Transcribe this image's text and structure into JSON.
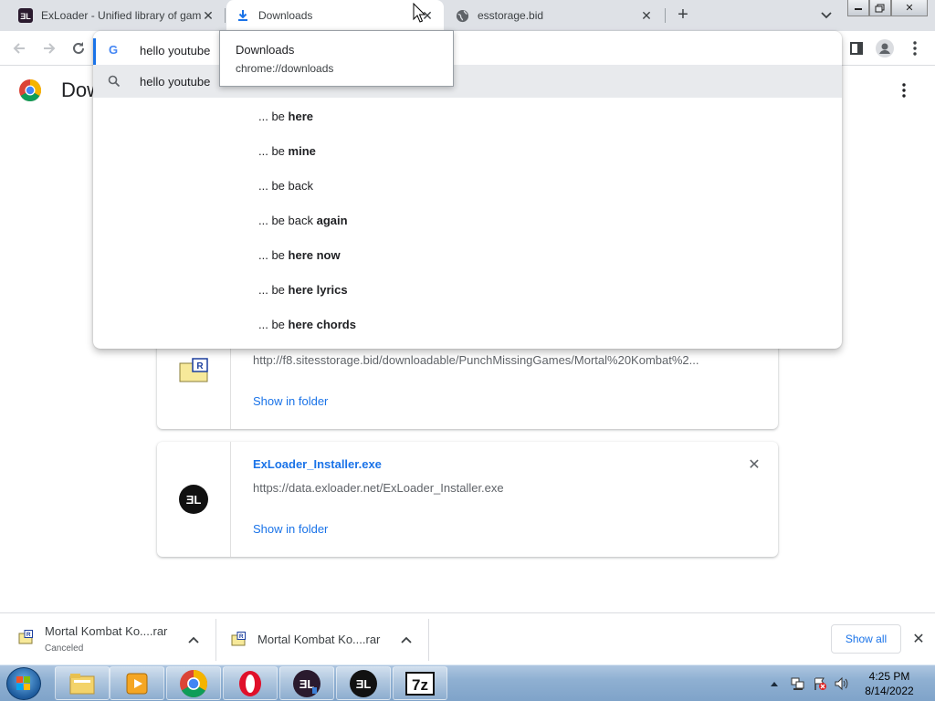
{
  "tabs": [
    {
      "title": "ExLoader - Unified library of games",
      "icon": "exloader-icon",
      "active": false
    },
    {
      "title": "Downloads",
      "icon": "download-icon",
      "active": true
    },
    {
      "title": "esstorage.bid",
      "icon": "globe-icon",
      "active": false
    }
  ],
  "omnibox": {
    "text": "hello youtube",
    "first_suggestion": "hello youtube",
    "suggestions": [
      {
        "prefix": "... be ",
        "bold": "here"
      },
      {
        "prefix": "... be ",
        "bold": "mine"
      },
      {
        "prefix": "... be back",
        "bold": ""
      },
      {
        "prefix": "... be back ",
        "bold": "again"
      },
      {
        "prefix": "... be ",
        "bold": "here now"
      },
      {
        "prefix": "... be ",
        "bold": "here lyrics"
      },
      {
        "prefix": "... be ",
        "bold": "here chords"
      }
    ]
  },
  "tooltip": {
    "title": "Downloads",
    "url": "chrome://downloads"
  },
  "page": {
    "title": "Downloads"
  },
  "downloads": [
    {
      "url": "http://f8.sitesstorage.bid/downloadable/PunchMissingGames/Mortal%20Kombat%2...",
      "action": "Show in folder"
    },
    {
      "name": "ExLoader_Installer.exe",
      "url": "https://data.exloader.net/ExLoader_Installer.exe",
      "action": "Show in folder"
    }
  ],
  "shelf": {
    "items": [
      {
        "name": "Mortal Kombat Ko....rar",
        "status": "Canceled"
      },
      {
        "name": "Mortal Kombat Ko....rar",
        "status": ""
      }
    ],
    "show_all": "Show all"
  },
  "clock": {
    "time": "4:25 PM",
    "date": "8/14/2022"
  },
  "colors": {
    "accent": "#1a73e8",
    "tabstrip": "#dee1e6"
  }
}
